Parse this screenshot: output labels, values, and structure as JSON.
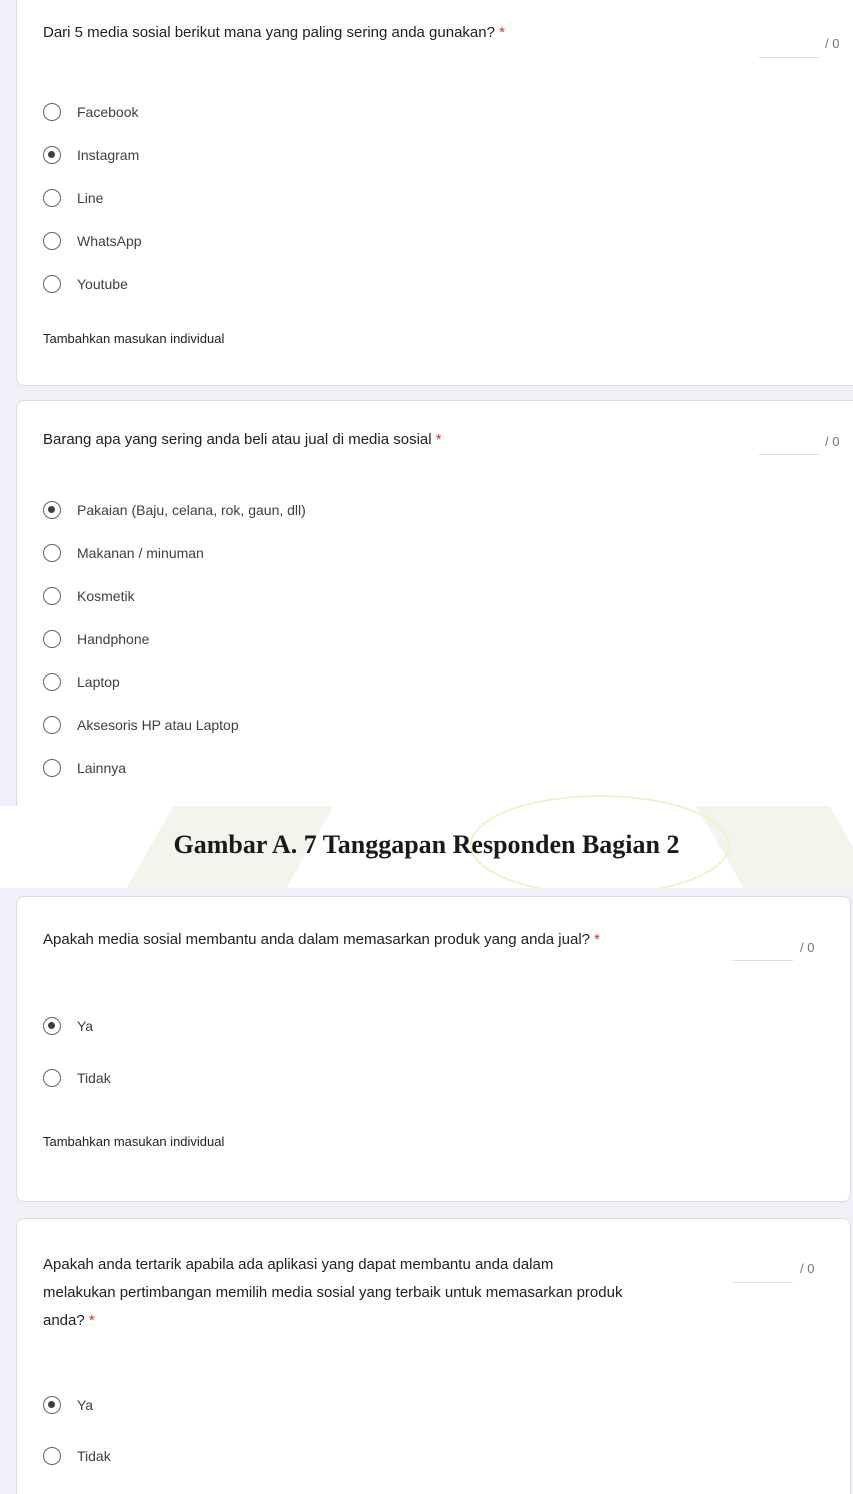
{
  "caption": "Gambar A. 7 Tanggapan Responden Bagian 2",
  "score_suffix": "/ 0",
  "required_mark": "*",
  "feedback_label": "Tambahkan masukan individual",
  "questions": [
    {
      "text": "Dari 5 media sosial berikut mana yang paling sering anda gunakan?",
      "options": [
        {
          "label": "Facebook",
          "selected": false
        },
        {
          "label": "Instagram",
          "selected": true
        },
        {
          "label": "Line",
          "selected": false
        },
        {
          "label": "WhatsApp",
          "selected": false
        },
        {
          "label": "Youtube",
          "selected": false
        }
      ]
    },
    {
      "text": "Barang apa yang sering anda beli atau jual di media sosial",
      "options": [
        {
          "label": "Pakaian (Baju, celana, rok, gaun, dll)",
          "selected": true
        },
        {
          "label": "Makanan / minuman",
          "selected": false
        },
        {
          "label": "Kosmetik",
          "selected": false
        },
        {
          "label": "Handphone",
          "selected": false
        },
        {
          "label": "Laptop",
          "selected": false
        },
        {
          "label": "Aksesoris HP atau Laptop",
          "selected": false
        },
        {
          "label": "Lainnya",
          "selected": false
        }
      ]
    },
    {
      "text": "Apakah media sosial membantu anda dalam memasarkan produk yang anda jual?",
      "options": [
        {
          "label": "Ya",
          "selected": true
        },
        {
          "label": "Tidak",
          "selected": false
        }
      ]
    },
    {
      "text_lines": [
        "Apakah anda tertarik apabila ada aplikasi yang dapat membantu anda dalam",
        "melakukan pertimbangan memilih media sosial yang terbaik untuk memasarkan produk",
        "anda?"
      ],
      "options": [
        {
          "label": "Ya",
          "selected": true
        },
        {
          "label": "Tidak",
          "selected": false
        }
      ]
    }
  ]
}
